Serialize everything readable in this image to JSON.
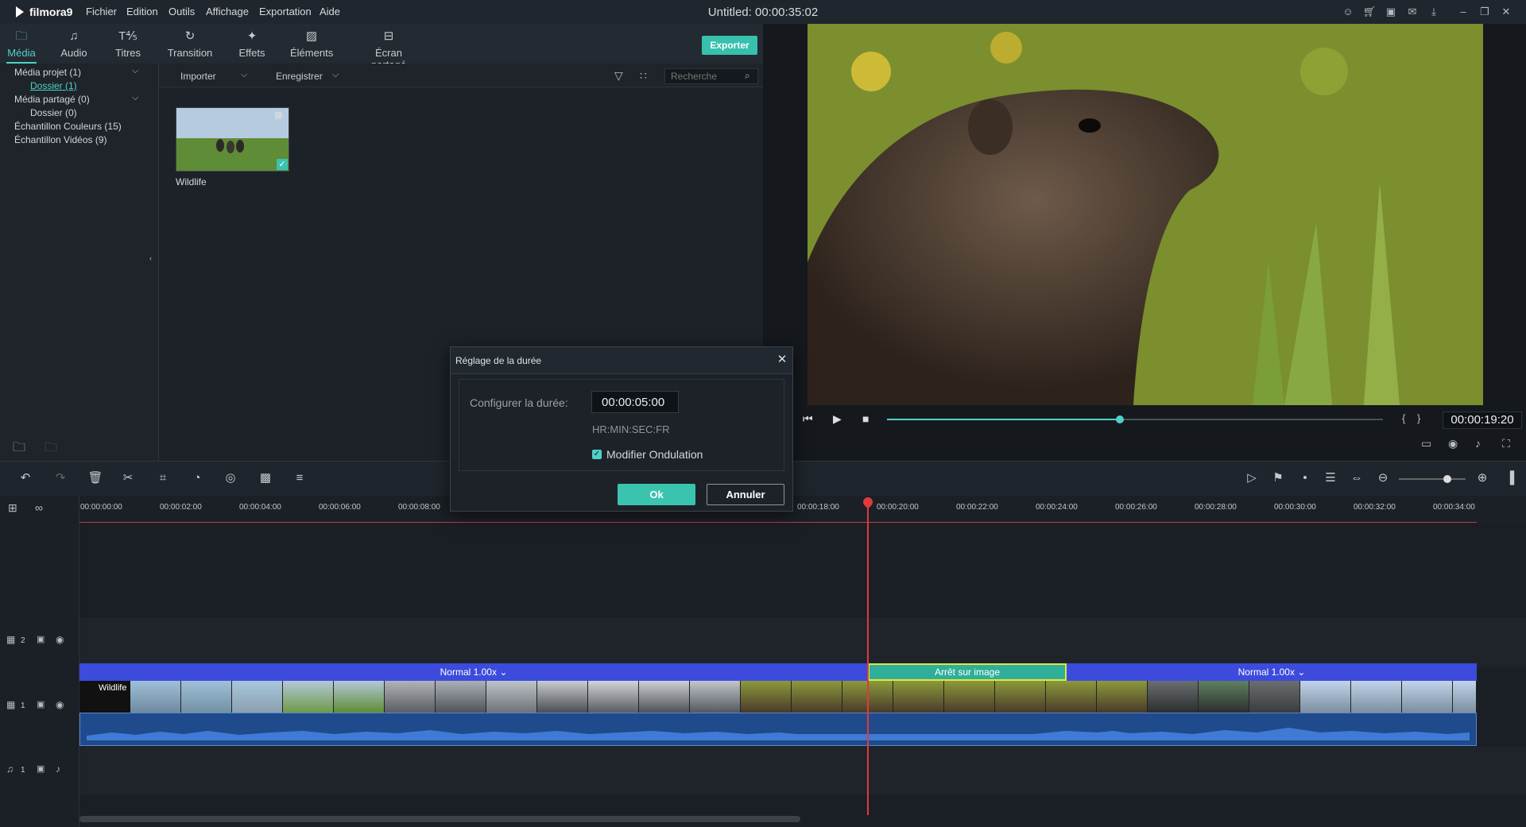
{
  "app": {
    "logo_text": "filmora9",
    "window_title": "Untitled: 00:00:35:02",
    "menu": [
      "Fichier",
      "Edition",
      "Outils",
      "Affichage",
      "Exportation",
      "Aide"
    ]
  },
  "tabs": [
    {
      "label": "Média",
      "icon": "folder-icon"
    },
    {
      "label": "Audio",
      "icon": "music-note-icon"
    },
    {
      "label": "Titres",
      "icon": "text-icon"
    },
    {
      "label": "Transition",
      "icon": "transition-icon"
    },
    {
      "label": "Effets",
      "icon": "effects-icon"
    },
    {
      "label": "Éléments",
      "icon": "image-icon"
    },
    {
      "label": "Écran partagé",
      "icon": "split-screen-icon"
    }
  ],
  "export_label": "Exporter",
  "library": {
    "tree": [
      {
        "label": "Média projet (1)"
      },
      {
        "label": "Dossier (1)"
      },
      {
        "label": "Média partagé (0)"
      },
      {
        "label": "Dossier (0)"
      },
      {
        "label": "Échantillon Couleurs (15)"
      },
      {
        "label": "Échantillon Vidéos (9)"
      }
    ],
    "import_label": "Importer",
    "record_label": "Enregistrer",
    "search_placeholder": "Recherche",
    "media_items": [
      {
        "name": "Wildlife"
      }
    ]
  },
  "preview": {
    "timecode": "00:00:19:20",
    "progress": 0.47
  },
  "timeline": {
    "ticks": [
      "00:00:00:00",
      "00:00:02:00",
      "00:00:04:00",
      "00:00:06:00",
      "00:00:08:00",
      "00:00:18:00",
      "00:00:20:00",
      "00:00:22:00",
      "00:00:24:00",
      "00:00:26:00",
      "00:00:28:00",
      "00:00:30:00",
      "00:00:32:00",
      "00:00:34:00"
    ],
    "tracks": {
      "v2": "2",
      "v1": "1",
      "a1": "1"
    },
    "clip_name": "Wildlife",
    "segments": [
      {
        "label": "Normal 1.00x"
      },
      {
        "label": "Arrêt sur image"
      },
      {
        "label": "Normal 1.00x"
      }
    ]
  },
  "dialog": {
    "title": "Réglage de la durée",
    "duration_label": "Configurer la durée:",
    "duration_value": "00:00:05:00",
    "format_hint": "HR:MIN:SEC:FR",
    "ripple_label": "Modifier Ondulation",
    "ripple_checked": true,
    "ok_label": "Ok",
    "cancel_label": "Annuler"
  },
  "colors": {
    "accent": "#4fd1c5",
    "export_button": "#36c0ad",
    "clip_header": "#3c4bdc",
    "freeze_segment": "#2fae9a",
    "playhead": "#e03a3a"
  }
}
